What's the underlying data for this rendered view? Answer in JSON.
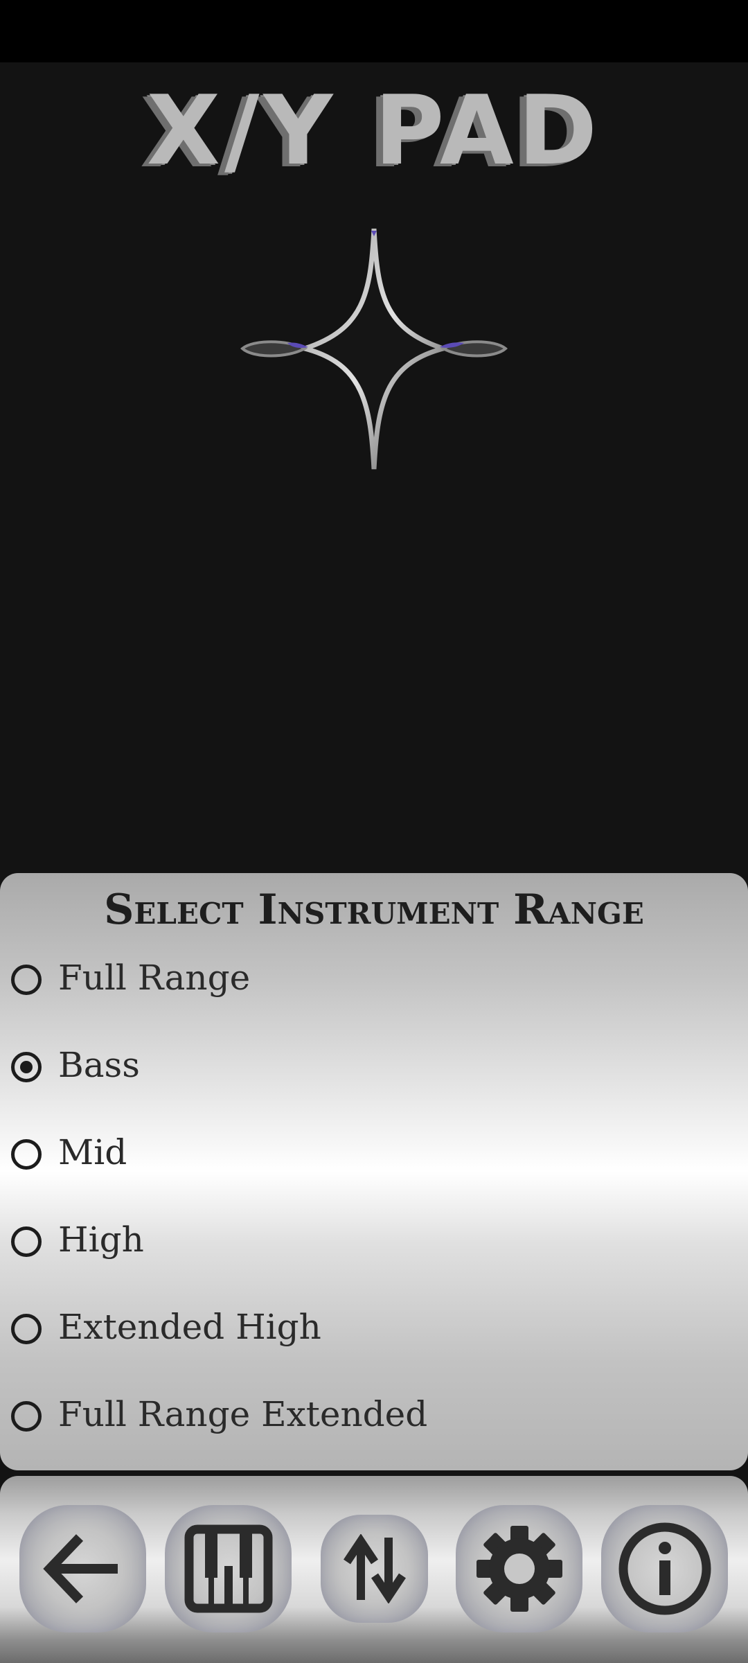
{
  "header": {
    "title": "X/Y PAD"
  },
  "range_sheet": {
    "title": "Select Instrument Range",
    "options": [
      {
        "label": "Full Range",
        "selected": false
      },
      {
        "label": "Bass",
        "selected": true
      },
      {
        "label": "Mid",
        "selected": false
      },
      {
        "label": "High",
        "selected": false
      },
      {
        "label": "Extended High",
        "selected": false
      },
      {
        "label": "Full Range Extended",
        "selected": false
      }
    ]
  },
  "toolbar": {
    "buttons": [
      {
        "icon": "back-arrow-icon"
      },
      {
        "icon": "piano-keys-icon"
      },
      {
        "icon": "swap-vertical-icon"
      },
      {
        "icon": "gear-icon"
      },
      {
        "icon": "info-icon"
      }
    ]
  },
  "colors": {
    "background": "#131313",
    "accent": "#5b4bb5"
  }
}
